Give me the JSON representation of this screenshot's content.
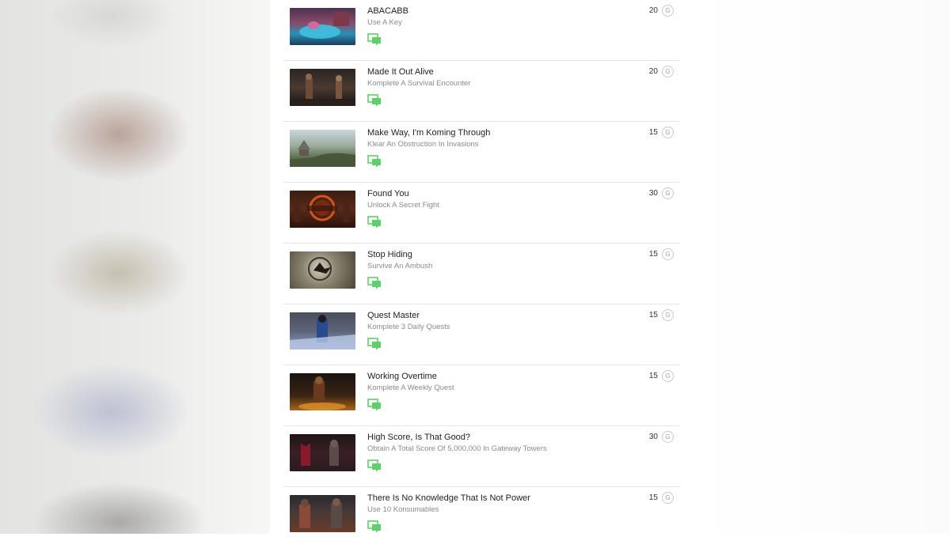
{
  "achievements": [
    {
      "title": "ABACABB",
      "description": "Use A Key",
      "score": "20",
      "currency_icon": "G",
      "image": "pool-scene"
    },
    {
      "title": "Made It Out Alive",
      "description": "Komplete A Survival Encounter",
      "score": "20",
      "currency_icon": "G",
      "image": "dark-cave-fighter"
    },
    {
      "title": "Make Way, I'm Koming Through",
      "description": "Klear An Obstruction In Invasions",
      "score": "15",
      "currency_icon": "G",
      "image": "landscape-temple"
    },
    {
      "title": "Found You",
      "description": "Unlock A Secret Fight",
      "score": "30",
      "currency_icon": "G",
      "image": "secret-fight-logo"
    },
    {
      "title": "Stop Hiding",
      "description": "Survive An Ambush",
      "score": "15",
      "currency_icon": "G",
      "image": "ambush-explosion"
    },
    {
      "title": "Quest Master",
      "description": "Komplete 3 Daily Quests",
      "score": "15",
      "currency_icon": "G",
      "image": "blue-fighter"
    },
    {
      "title": "Working Overtime",
      "description": "Komplete A Weekly Quest",
      "score": "15",
      "currency_icon": "G",
      "image": "fire-scene"
    },
    {
      "title": "High Score, Is That Good?",
      "description": "Obtain A Total Score Of 5,000,000 In Gateway Towers",
      "score": "30",
      "currency_icon": "G",
      "image": "red-fighter"
    },
    {
      "title": "There Is No Knowledge That Is Not Power",
      "description": "Use 10 Konsumables",
      "score": "15",
      "currency_icon": "G",
      "image": "warriors-duo"
    }
  ],
  "colors": {
    "comment_icon": "#5fcf6b",
    "title_text": "#222222",
    "description_text": "#8a8a8a",
    "divider": "#e6e6e6"
  }
}
